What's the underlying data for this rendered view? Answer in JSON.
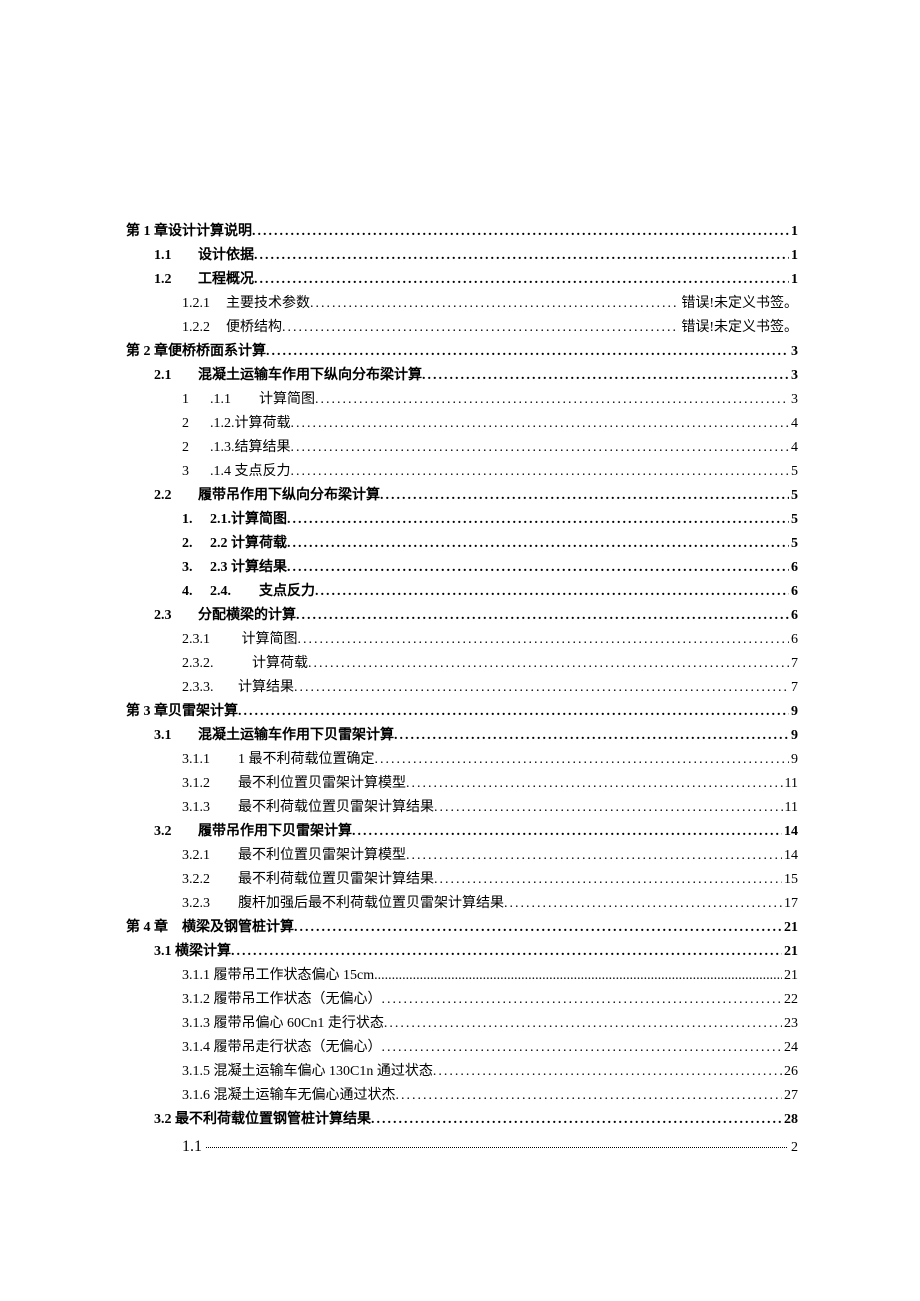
{
  "toc": [
    {
      "indent": 0,
      "bold": true,
      "label": "第 1 章设计计算说明",
      "page": "1"
    },
    {
      "indent": 1,
      "bold": true,
      "num": "1.1",
      "label": "设计依据",
      "page": "1"
    },
    {
      "indent": 1,
      "bold": true,
      "num": "1.2",
      "label": "工程概况",
      "page": "1"
    },
    {
      "indent": 2,
      "bold": false,
      "num": "1.2.1",
      "label": "主要技术参数",
      "page_text": "错误!未定义书签。"
    },
    {
      "indent": 2,
      "bold": false,
      "num": "1.2.2",
      "label": "便桥结构",
      "page_text": "错误!未定义书签。"
    },
    {
      "indent": 0,
      "bold": true,
      "label": "第 2 章便桥桥面系计算",
      "page": "3"
    },
    {
      "indent": 1,
      "bold": true,
      "num": "2.1",
      "label": "混凝土运输车作用下纵向分布梁计算",
      "page": "3"
    },
    {
      "indent": 2,
      "bold": false,
      "num_left": "1",
      "num_right": ".1.1",
      "label": "计算简图",
      "page": "3",
      "gap_after_num_right": true
    },
    {
      "indent": 2,
      "bold": false,
      "num_left": "2",
      "num_right": ".1.2.",
      "label_bare": "计算荷载",
      "page": "4"
    },
    {
      "indent": 2,
      "bold": false,
      "num_left": "2",
      "num_right": ".1.3.",
      "label_bare": "结算结果",
      "page": "4"
    },
    {
      "indent": 2,
      "bold": false,
      "num_left": "3",
      "num_right": ".1.4",
      "label_space": "支点反力",
      "page": "5"
    },
    {
      "indent": 1,
      "bold": true,
      "num": "2.2",
      "label": "履带吊作用下纵向分布梁计算",
      "page": "5"
    },
    {
      "indent": 2,
      "bold": true,
      "num_left": "1.",
      "num_right": "2.1.",
      "label_bare": "计算简图",
      "page": "5"
    },
    {
      "indent": 2,
      "bold": true,
      "num_left": "2.",
      "num_right": "2.2",
      "label_space": "计算荷载",
      "page": "5"
    },
    {
      "indent": 2,
      "bold": true,
      "num_left": "3.",
      "num_right": "2.3",
      "label_space": "计算结果",
      "page": "6"
    },
    {
      "indent": 2,
      "bold": true,
      "num_left": "4.",
      "num_right": "2.4.",
      "label": "支点反力",
      "page": "6",
      "gap_after_num_right": true
    },
    {
      "indent": 1,
      "bold": true,
      "num": "2.3",
      "label": "分配横梁的计算",
      "page": "6"
    },
    {
      "indent": 2,
      "bold": false,
      "num": "2.3.1",
      "label_space": "计算简图",
      "page": "6",
      "num_wide": true
    },
    {
      "indent": 2,
      "bold": false,
      "num": "2.3.2.",
      "label": "计算荷载",
      "page": "7",
      "num_wide": true,
      "gap_after_num": true
    },
    {
      "indent": 2,
      "bold": false,
      "num": "2.3.3.",
      "label_bare": "计算结果",
      "page": "7",
      "num_wide": true
    },
    {
      "indent": 0,
      "bold": true,
      "label": "第 3 章贝雷架计算",
      "page": "9"
    },
    {
      "indent": 1,
      "bold": true,
      "num": "3.1",
      "label": "混凝土运输车作用下贝雷架计算",
      "page": "9"
    },
    {
      "indent": 2,
      "bold": false,
      "num": "3.1.1",
      "label": "1 最不利荷载位置确定",
      "page": "9",
      "num_wide": true
    },
    {
      "indent": 2,
      "bold": false,
      "num": "3.1.2",
      "label": "最不利位置贝雷架计算模型",
      "page": "11",
      "num_wide": true
    },
    {
      "indent": 2,
      "bold": false,
      "num": "3.1.3",
      "label": "最不利荷载位置贝雷架计算结果",
      "page": "11",
      "num_wide": true
    },
    {
      "indent": 1,
      "bold": true,
      "num": "3.2",
      "label": "履带吊作用下贝雷架计算",
      "page": "14"
    },
    {
      "indent": 2,
      "bold": false,
      "num": "3.2.1",
      "label": "最不利位置贝雷架计算模型",
      "page": "14",
      "num_wide": true
    },
    {
      "indent": 2,
      "bold": false,
      "num": "3.2.2",
      "label": "最不利荷载位置贝雷架计算结果",
      "page": "15",
      "num_wide": true
    },
    {
      "indent": 2,
      "bold": false,
      "num": "3.2.3",
      "label": "腹杆加强后最不利荷载位置贝雷架计算结果",
      "page": "17",
      "num_wide": true
    },
    {
      "indent": 0,
      "bold": true,
      "label_parts": [
        "第 4 章",
        "横梁及钢管桩计算"
      ],
      "page": "21"
    },
    {
      "indent": 1,
      "bold": true,
      "label": "3.1 横梁计算",
      "page": "21"
    },
    {
      "indent": 2,
      "bold": false,
      "label": "3.1.1 履带吊工作状态偏心 15cm",
      "page": "21",
      "leader_style": "thin"
    },
    {
      "indent": 2,
      "bold": false,
      "label": "3.1.2 履带吊工作状态（无偏心）",
      "page": "22"
    },
    {
      "indent": 2,
      "bold": false,
      "label": "3.1.3 履带吊偏心 60Cn1 走行状态",
      "page": "23"
    },
    {
      "indent": 2,
      "bold": false,
      "label": "3.1.4 履带吊走行状态（无偏心）",
      "page": "24"
    },
    {
      "indent": 2,
      "bold": false,
      "label": "3.1.5 混凝土运输车偏心 130C1n 通过状态",
      "page": "26"
    },
    {
      "indent": 2,
      "bold": false,
      "label": "3.1.6 混凝土运输车无偏心通过状杰",
      "page": "27"
    },
    {
      "indent": 1,
      "bold": true,
      "label": "3.2 最不利荷载位置钢管桩计算结果",
      "page": "28"
    }
  ],
  "last": {
    "num": "1.1",
    "page": "2"
  }
}
